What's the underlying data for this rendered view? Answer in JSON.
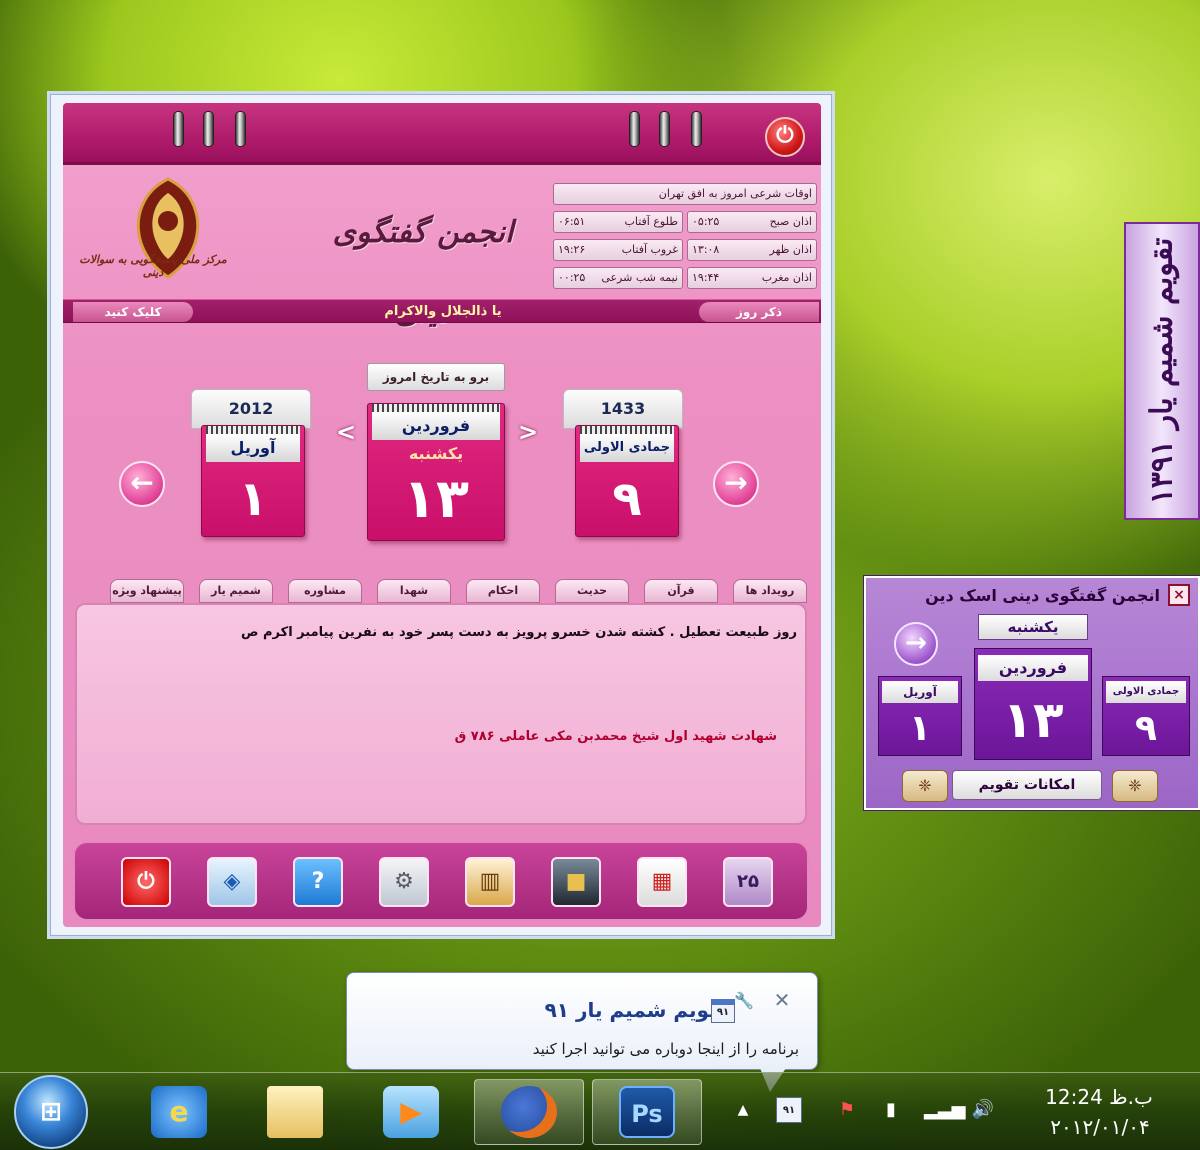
{
  "main_window": {
    "header_title": "انجمن گفتگوی دینی",
    "logo_caption": "مرکز ملی پاسخگویی به سوالات دینی",
    "prayer_times": {
      "heading": "اوقات شرعی امروز به افق تهران",
      "rows": [
        {
          "label_a": "اذان صبح",
          "value_a": "۰۵:۲۵",
          "label_b": "طلوع آفتاب",
          "value_b": "۰۶:۵۱"
        },
        {
          "label_a": "اذان ظهر",
          "value_a": "۱۳:۰۸",
          "label_b": "غروب آفتاب",
          "value_b": "۱۹:۲۶"
        },
        {
          "label_a": "اذان مغرب",
          "value_a": "۱۹:۴۴",
          "label_b": "نیمه شب شرعی",
          "value_b": "۰۰:۲۵"
        }
      ]
    },
    "stripe": {
      "click_label": "کلیک کنید",
      "center_text": "یا ذالجلال والاکرام",
      "zekr_label": "ذکر روز"
    },
    "goto_today": "برو به تاریخ امروز",
    "gregorian": {
      "year": "2012",
      "month": "آوریل",
      "day": "۱"
    },
    "persian": {
      "month": "فروردین",
      "weekday": "یکشنبه",
      "day": "۱۳"
    },
    "hijri": {
      "year": "1433",
      "month": "جمادی الاولی",
      "day": "۹"
    },
    "nav": {
      "prev": "←",
      "next": "→",
      "small_prev": "<",
      "small_next": ">"
    },
    "tabs": [
      "رویداد ها",
      "قرآن",
      "حدیث",
      "احکام",
      "شهدا",
      "مشاوره",
      "شمیم یار",
      "پیشنهاد ویژه"
    ],
    "content": {
      "line1": "روز طبیعت تعطیل . کشته شدن خسرو پرویز به دست پسر خود به نفرین پیامبر اکرم ص",
      "line2": "شهادت شهید اول شیخ محمدبن مکی عاملی ۷۸۶ ق"
    },
    "toolbar_icons": [
      "power-icon",
      "logo-icon",
      "help-icon",
      "settings-icon",
      "book-icon",
      "kaaba-icon",
      "calendar-icon",
      "date-25-icon"
    ],
    "toolbar_date_badge": "۲۵"
  },
  "side_title": "تقویم شمیم یار ۱۳۹۱",
  "mini_widget": {
    "title": "انجمن گفتگوی دینی اسک دین",
    "weekday": "یکشنبه",
    "persian_month": "فروردین",
    "persian_day": "۱۳",
    "gregorian_month": "آوریل",
    "gregorian_day": "۱",
    "hijri_month": "جمادی الاولی",
    "hijri_day": "۹",
    "features_button": "امکانات تقویم",
    "close": "×",
    "next": "→"
  },
  "balloon": {
    "title": "تقویم شمیم یار ۹۱",
    "icon_text": "۹۱",
    "text": "برنامه را از اینجا دوباره می توانید اجرا کنید",
    "close": "✕",
    "wrench": "🔧"
  },
  "taskbar": {
    "clock_time": "12:24 ب.ظ",
    "clock_date": "۲۰۱۲/۰۱/۰۴",
    "photoshop_label": "Ps",
    "tray_badge": "۹۱"
  },
  "colors": {
    "pink_primary": "#e2287f",
    "pink_dark": "#98105b",
    "purple_widget": "#9c66c6",
    "balloon_title": "#1f3d8a"
  }
}
